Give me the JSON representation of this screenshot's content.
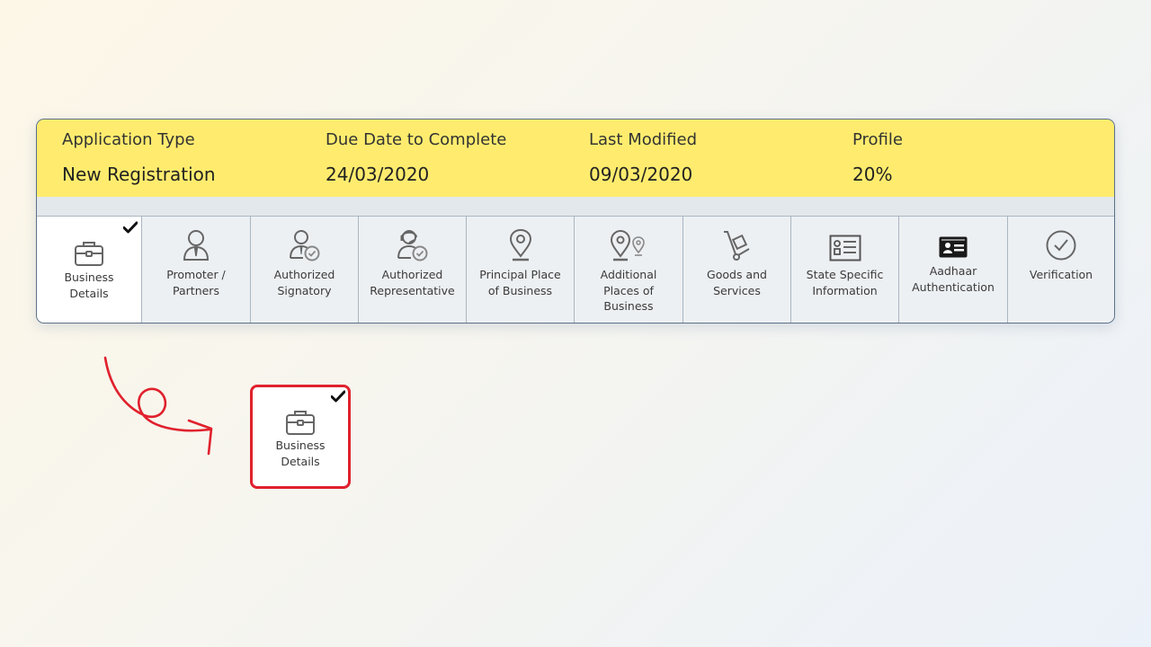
{
  "header": {
    "columns": [
      {
        "label": "Application Type",
        "value": "New Registration"
      },
      {
        "label": "Due Date to Complete",
        "value": "24/03/2020"
      },
      {
        "label": "Last Modified",
        "value": "09/03/2020"
      },
      {
        "label": "Profile",
        "value": "20%"
      }
    ]
  },
  "tabs": [
    {
      "label": "Business\nDetails",
      "icon": "briefcase-icon",
      "active": true,
      "completed": true
    },
    {
      "label": "Promoter /\nPartners",
      "icon": "person-tie-icon"
    },
    {
      "label": "Authorized\nSignatory",
      "icon": "person-check-icon"
    },
    {
      "label": "Authorized\nRepresentative",
      "icon": "headset-person-check-icon"
    },
    {
      "label": "Principal Place\nof Business",
      "icon": "map-pin-icon"
    },
    {
      "label": "Additional\nPlaces of\nBusiness",
      "icon": "map-pins-icon"
    },
    {
      "label": "Goods and\nServices",
      "icon": "hand-truck-icon"
    },
    {
      "label": "State Specific\nInformation",
      "icon": "info-card-icon"
    },
    {
      "label": "Aadhaar\nAuthentication",
      "icon": "id-card-icon"
    },
    {
      "label": "Verification",
      "icon": "check-circle-icon"
    }
  ],
  "callout": {
    "label": "Business\nDetails",
    "icon": "briefcase-icon",
    "completed": true
  },
  "colors": {
    "header_bg": "#ffec6e",
    "highlight": "#e0212d",
    "active_tab": "#ffffff"
  }
}
